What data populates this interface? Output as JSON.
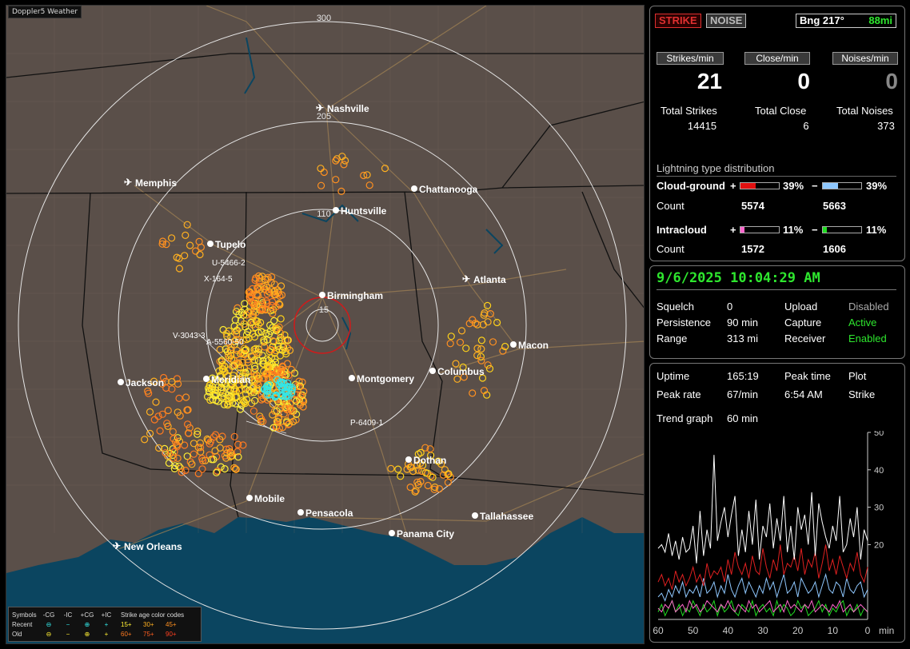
{
  "app": {
    "brand": "Doppler5 Weather"
  },
  "map": {
    "ring_labels": [
      "300",
      "205",
      "110",
      "15"
    ],
    "cities": [
      {
        "name": "Nashville",
        "airport": true
      },
      {
        "name": "Memphis",
        "airport": true
      },
      {
        "name": "Chattanooga",
        "airport": false
      },
      {
        "name": "Huntsville",
        "airport": false
      },
      {
        "name": "Tupelo",
        "airport": false
      },
      {
        "name": "Birmingham",
        "airport": false
      },
      {
        "name": "Atlanta",
        "airport": true
      },
      {
        "name": "Macon",
        "airport": false
      },
      {
        "name": "Jackson",
        "airport": false
      },
      {
        "name": "Meridian",
        "airport": false
      },
      {
        "name": "Montgomery",
        "airport": false
      },
      {
        "name": "Columbus",
        "airport": false
      },
      {
        "name": "Dothan",
        "airport": false
      },
      {
        "name": "Mobile",
        "airport": false
      },
      {
        "name": "Pensacola",
        "airport": false
      },
      {
        "name": "Tallahassee",
        "airport": false
      },
      {
        "name": "Panama City",
        "airport": false
      },
      {
        "name": "New Orleans",
        "airport": true
      }
    ],
    "storm_labels": [
      "U-5466-2",
      "X-164-5",
      "V-3043-3",
      "A-5560-50",
      "P-6409-1"
    ],
    "colors": {
      "land": "#5a4f49",
      "water": "#0b4560",
      "roads": "#9a7d53",
      "state": "#111111",
      "ring": "#e6e6e6",
      "center_ring": "#d11a1a"
    }
  },
  "legend": {
    "header": [
      "Symbols",
      "-CG",
      "-IC",
      "+CG",
      "+IC",
      "Strike age color codes"
    ],
    "recent": {
      "label": "Recent",
      "codes": [
        "15+",
        "30+",
        "45+"
      ]
    },
    "old": {
      "label": "Old",
      "codes": [
        "60+",
        "75+",
        "90+"
      ]
    }
  },
  "status": {
    "strike_label": "STRIKE",
    "noise_label": "NOISE",
    "bearing_label": "Bng 217°",
    "distance": "88mi"
  },
  "rates": {
    "strikes_label": "Strikes/min",
    "strikes_value": "21",
    "close_label": "Close/min",
    "close_value": "0",
    "noises_label": "Noises/min",
    "noises_value": "0"
  },
  "totals": {
    "strikes_label": "Total Strikes",
    "strikes_value": "14415",
    "close_label": "Total Close",
    "close_value": "6",
    "noises_label": "Total Noises",
    "noises_value": "373"
  },
  "distribution": {
    "title": "Lightning type distribution",
    "cg_label": "Cloud-ground",
    "cg_pos_pct": "39%",
    "cg_pos_fill": 0.39,
    "cg_neg_pct": "39%",
    "cg_neg_fill": 0.39,
    "count_label": "Count",
    "cg_pos_count": "5574",
    "cg_neg_count": "5663",
    "ic_label": "Intracloud",
    "ic_pos_pct": "11%",
    "ic_pos_fill": 0.11,
    "ic_neg_pct": "11%",
    "ic_neg_fill": 0.11,
    "ic_pos_count": "1572",
    "ic_neg_count": "1606",
    "plus": "+",
    "minus": "−"
  },
  "clock": {
    "datetime": "9/6/2025 10:04:29 AM"
  },
  "settings": {
    "squelch_label": "Squelch",
    "squelch_value": "0",
    "persistence_label": "Persistence",
    "persistence_value": "90 min",
    "range_label": "Range",
    "range_value": "313 mi",
    "upload_label": "Upload",
    "upload_value": "Disabled",
    "capture_label": "Capture",
    "capture_value": "Active",
    "receiver_label": "Receiver",
    "receiver_value": "Enabled"
  },
  "stats": {
    "uptime_label": "Uptime",
    "uptime_value": "165:19",
    "peak_time_label": "Peak time",
    "peak_time_value": "6:54 AM",
    "plot_label": "Plot",
    "plot_value": "Strike",
    "peak_rate_label": "Peak rate",
    "peak_rate_value": "67/min",
    "trend_label": "Trend graph",
    "trend_value": "60 min"
  },
  "chart_data": {
    "type": "line",
    "x": [
      60,
      59,
      58,
      57,
      56,
      55,
      54,
      53,
      52,
      51,
      50,
      49,
      48,
      47,
      46,
      45,
      44,
      43,
      42,
      41,
      40,
      39,
      38,
      37,
      36,
      35,
      34,
      33,
      32,
      31,
      30,
      29,
      28,
      27,
      26,
      25,
      24,
      23,
      22,
      21,
      20,
      19,
      18,
      17,
      16,
      15,
      14,
      13,
      12,
      11,
      10,
      9,
      8,
      7,
      6,
      5,
      4,
      3,
      2,
      1,
      0
    ],
    "x_ticks": [
      "60",
      "50",
      "40",
      "30",
      "20",
      "10",
      "0"
    ],
    "x_unit": "min",
    "y_ticks": [
      "50",
      "40",
      "30",
      "20"
    ],
    "ylim": [
      0,
      50
    ],
    "series": [
      {
        "color": "#ffffff",
        "values": [
          19,
          20,
          18,
          23,
          17,
          21,
          16,
          22,
          18,
          19,
          25,
          15,
          29,
          17,
          24,
          19,
          44,
          21,
          26,
          30,
          22,
          28,
          33,
          17,
          24,
          18,
          29,
          20,
          32,
          16,
          25,
          22,
          31,
          19,
          27,
          21,
          33,
          18,
          25,
          16,
          30,
          24,
          28,
          20,
          34,
          17,
          31,
          26,
          22,
          19,
          25,
          21,
          33,
          18,
          20,
          27,
          22,
          30,
          16,
          24,
          21
        ]
      },
      {
        "color": "#e02020",
        "values": [
          10,
          12,
          9,
          11,
          8,
          13,
          10,
          12,
          9,
          11,
          14,
          10,
          12,
          9,
          15,
          11,
          13,
          12,
          14,
          10,
          16,
          12,
          18,
          14,
          12,
          15,
          11,
          17,
          13,
          12,
          19,
          14,
          11,
          16,
          13,
          20,
          12,
          15,
          14,
          17,
          13,
          19,
          12,
          16,
          14,
          18,
          11,
          15,
          20,
          13,
          16,
          12,
          17,
          14,
          11,
          15,
          13,
          18,
          12,
          10,
          14
        ]
      },
      {
        "color": "#8fc8ff",
        "values": [
          6,
          7,
          5,
          8,
          6,
          9,
          7,
          10,
          6,
          8,
          7,
          9,
          6,
          11,
          7,
          8,
          10,
          6,
          9,
          7,
          12,
          8,
          6,
          9,
          11,
          7,
          10,
          8,
          6,
          9,
          7,
          11,
          8,
          10,
          6,
          9,
          12,
          7,
          8,
          10,
          6,
          11,
          9,
          7,
          8,
          10,
          6,
          9,
          12,
          8,
          7,
          10,
          9,
          6,
          11,
          8,
          7,
          9,
          10,
          6,
          8
        ]
      },
      {
        "color": "#ff66cc",
        "values": [
          3,
          2,
          4,
          3,
          5,
          2,
          3,
          4,
          2,
          5,
          3,
          4,
          2,
          3,
          5,
          4,
          3,
          2,
          4,
          3,
          5,
          3,
          2,
          4,
          3,
          2,
          5,
          3,
          4,
          2,
          3,
          4,
          5,
          2,
          3,
          4,
          2,
          5,
          3,
          4,
          3,
          2,
          4,
          3,
          5,
          2,
          3,
          4,
          3,
          2,
          4,
          3,
          5,
          2,
          3,
          4,
          2,
          3,
          4,
          3,
          2
        ]
      },
      {
        "color": "#22dd22",
        "values": [
          2,
          4,
          1,
          3,
          5,
          2,
          4,
          1,
          3,
          2,
          5,
          3,
          1,
          4,
          2,
          3,
          5,
          1,
          4,
          2,
          3,
          5,
          2,
          1,
          4,
          3,
          2,
          5,
          1,
          3,
          4,
          2,
          3,
          1,
          5,
          2,
          4,
          3,
          1,
          2,
          5,
          3,
          4,
          1,
          2,
          3,
          5,
          2,
          4,
          1,
          3,
          2,
          4,
          5,
          1,
          3,
          2,
          4,
          1,
          3,
          2
        ]
      }
    ]
  }
}
